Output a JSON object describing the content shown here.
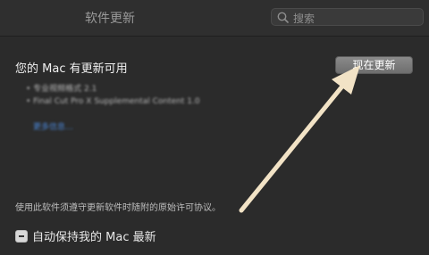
{
  "window": {
    "title": "软件更新"
  },
  "search": {
    "placeholder": "搜索",
    "icon": "search-icon"
  },
  "main": {
    "headline": "您的 Mac 有更新可用",
    "update_button": "现在更新",
    "updates": [
      "专业视频格式 2.1",
      "Final Cut Pro X Supplemental Content 1.0"
    ],
    "more_info": "更多信息…",
    "license_prefix": "使用此软件须遵守更新软件时随附的",
    "license_link": "原始许可协议",
    "license_suffix": "。",
    "auto_update_label": "自动保持我的 Mac 最新",
    "auto_update_state": "mixed"
  },
  "colors": {
    "background": "#2b2b2b",
    "annotation_arrow": "#f2e3c6",
    "link": "#4a86d6"
  }
}
